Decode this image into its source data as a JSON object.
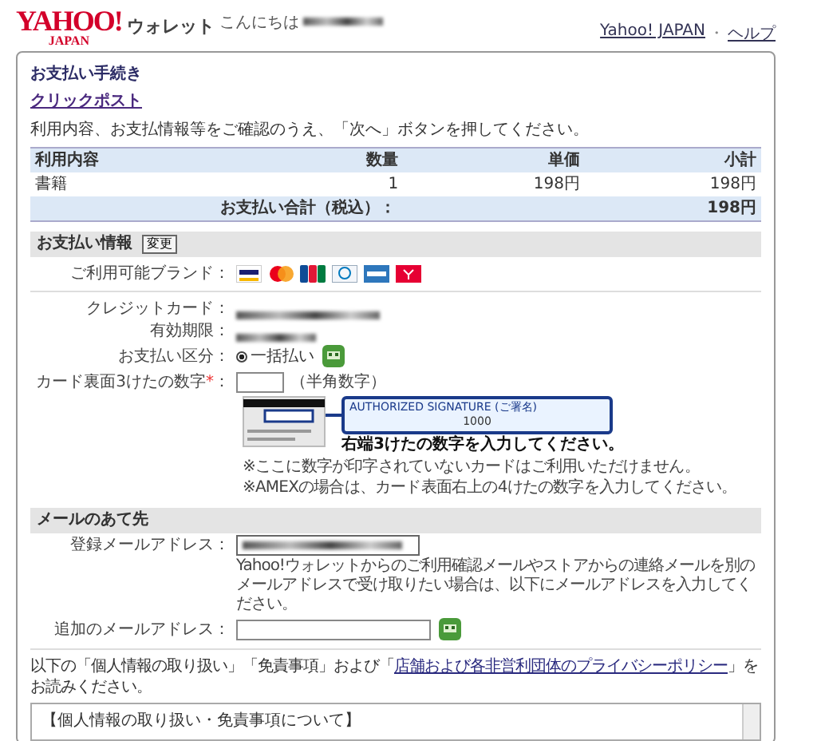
{
  "header": {
    "logo": {
      "brand": "YAHOO!",
      "sub": "JAPAN"
    },
    "service": "ウォレット",
    "greeting": "こんにちは",
    "links": [
      "Yahoo! JAPAN",
      "ヘルプ"
    ],
    "separator": "・"
  },
  "card": {
    "title": "お支払い手続き",
    "service_link": "クリックポスト",
    "instruction": "利用内容、お支払情報等をご確認のうえ、「次へ」ボタンを押してください。",
    "table": {
      "columns": [
        "利用内容",
        "数量",
        "単価",
        "小計"
      ],
      "rows": [
        [
          "書籍",
          "1",
          "198円",
          "198円"
        ]
      ],
      "total_label": "お支払い合計（税込）：",
      "total": "198円"
    },
    "payment": {
      "heading": "お支払い情報",
      "change_button": "変更",
      "brands_label": "ご利用可能ブランド：",
      "brands": [
        {
          "kind": "visa"
        },
        {
          "kind": "mastercard"
        },
        {
          "kind": "jcb"
        },
        {
          "kind": "diners"
        },
        {
          "kind": "amex"
        },
        {
          "kind": "yahoo"
        }
      ],
      "card_label": "クレジットカード：",
      "expiry_label": "有効期限：",
      "type_label": "お支払い区分：",
      "options": [
        {
          "label": "一括払い",
          "selected": true
        }
      ],
      "code_label": "カード裏面3けたの数字",
      "required": "*",
      "code_colon": "：",
      "code_hint": "（半角数字）",
      "illustration": {
        "signature": "AUTHORIZED SIGNATURE (ご署名)",
        "number": "1000",
        "caption": "右端3けたの数字を入力してください。"
      },
      "notes": [
        "※ここに数字が印字されていないカードはご利用いただけません。",
        "※AMEXの場合は、カード表面右上の4けたの数字を入力してください。"
      ]
    },
    "mail": {
      "heading": "メールのあて先",
      "registered_label": "登録メールアドレス：",
      "note": "Yahoo!ウォレットからのご利用確認メールやストアからの連絡メールを別のメールアドレスで受け取りたい場合は、以下にメールアドレスを入力してください。",
      "additional_label": "追加のメールアドレス："
    },
    "privacy": {
      "before": "以下の「個人情報の取り扱い」「免責事項」および「",
      "link": "店舗および各非営利団体のプライバシーポリシー",
      "after": "」をお読みください。"
    },
    "terms_box": {
      "heading": "【個人情報の取り扱い・免責事項について】"
    }
  }
}
